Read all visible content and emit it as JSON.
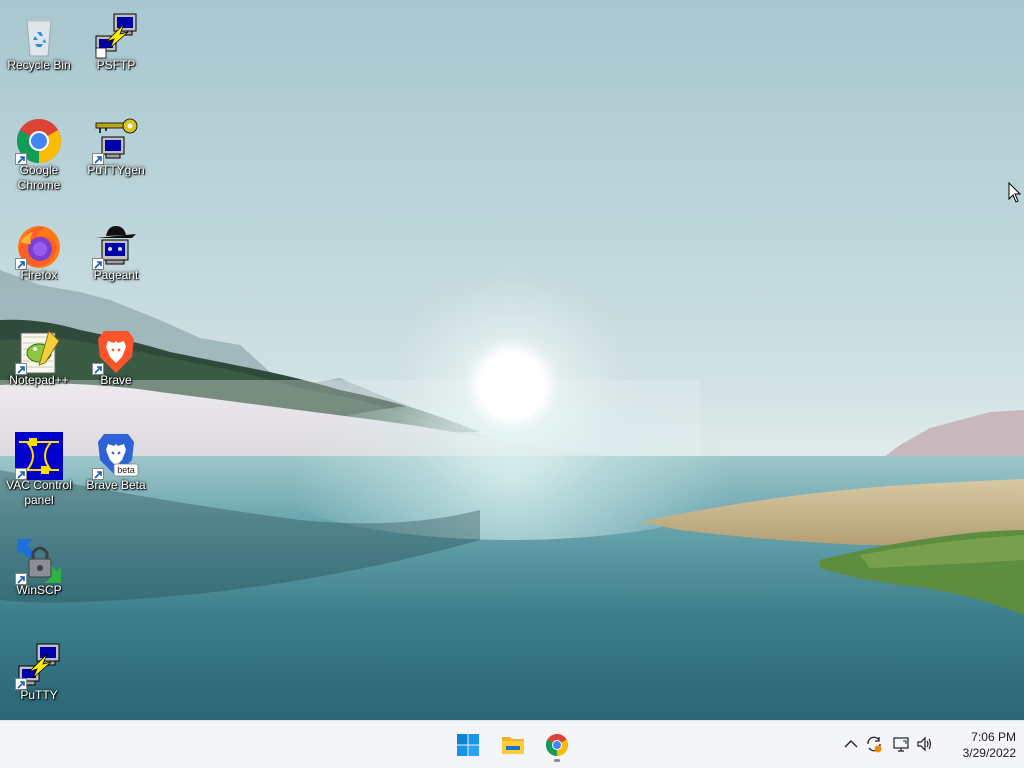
{
  "desktop": {
    "icons": [
      {
        "label": "Recycle Bin",
        "icon": "recycle-bin-icon"
      },
      {
        "label": "PSFTP",
        "icon": "psftp-icon"
      },
      {
        "label": "Google Chrome",
        "icon": "chrome-icon"
      },
      {
        "label": "PuTTYgen",
        "icon": "puttygen-icon"
      },
      {
        "label": "Firefox",
        "icon": "firefox-icon"
      },
      {
        "label": "Pageant",
        "icon": "pageant-icon"
      },
      {
        "label": "Notepad++",
        "icon": "notepadpp-icon"
      },
      {
        "label": "Brave",
        "icon": "brave-icon"
      },
      {
        "label": "VAC Control panel",
        "icon": "vac-icon"
      },
      {
        "label": "Brave Beta",
        "icon": "brave-beta-icon",
        "badge": "beta"
      },
      {
        "label": "WinSCP",
        "icon": "winscp-icon"
      },
      {
        "label": "PuTTY",
        "icon": "putty-icon"
      }
    ]
  },
  "taskbar": {
    "apps": [
      {
        "name": "Start",
        "icon": "windows-start-icon"
      },
      {
        "name": "File Explorer",
        "icon": "file-explorer-icon"
      },
      {
        "name": "Google Chrome",
        "icon": "chrome-icon",
        "running": true
      }
    ],
    "tray": [
      "chevron-up-icon",
      "sync-icon",
      "network-icon",
      "volume-icon"
    ],
    "clock": {
      "time": "7:06 PM",
      "date": "3/29/2022"
    }
  },
  "colors": {
    "taskbar_bg": "#f3f5f8",
    "accent": "#0078d4"
  }
}
